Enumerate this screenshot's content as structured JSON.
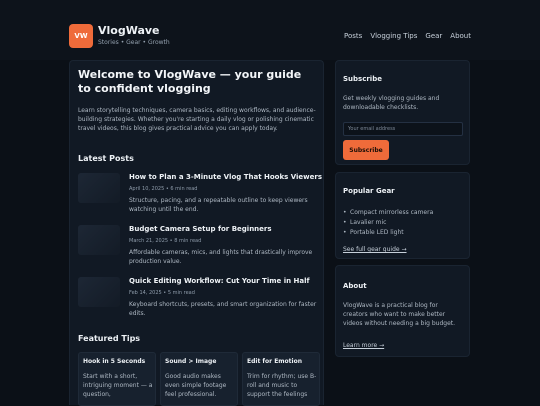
{
  "header": {
    "logo_text": "VW",
    "brand_name": "VlogWave",
    "tagline": "Stories • Gear • Growth",
    "nav": [
      "Posts",
      "Vlogging Tips",
      "Gear",
      "About"
    ]
  },
  "main": {
    "title": "Welcome to VlogWave — your guide to confident vlogging",
    "description": "Learn storytelling techniques, camera basics, editing workflows, and audience-building strategies. Whether you're starting a daily vlog or polishing cinematic travel videos, this blog gives practical advice you can apply today.",
    "latest_heading": "Latest Posts",
    "posts": [
      {
        "title": "How to Plan a 3-Minute Vlog That Hooks Viewers",
        "meta": "April 10, 2025 • 6 min read",
        "excerpt": "Structure, pacing, and a repeatable outline to keep viewers watching until the end."
      },
      {
        "title": "Budget Camera Setup for Beginners",
        "meta": "March 21, 2025 • 8 min read",
        "excerpt": "Affordable cameras, mics, and lights that drastically improve production value."
      },
      {
        "title": "Quick Editing Workflow: Cut Your Time in Half",
        "meta": "Feb 14, 2025 • 5 min read",
        "excerpt": "Keyboard shortcuts, presets, and smart organization for faster edits."
      }
    ],
    "featured_heading": "Featured Tips",
    "tips": [
      {
        "title": "Hook in 5 Seconds",
        "text": "Start with a short, intriguing moment — a question,"
      },
      {
        "title": "Sound > Image",
        "text": "Good audio makes even simple footage feel professional."
      },
      {
        "title": "Edit for Emotion",
        "text": "Trim for rhythm; use B-roll and music to support the feelings"
      }
    ]
  },
  "subscribe": {
    "heading": "Subscribe",
    "text": "Get weekly vlogging guides and downloadable checklists.",
    "placeholder": "Your email address",
    "button": "Subscribe"
  },
  "gear": {
    "heading": "Popular Gear",
    "items": [
      "Compact mirrorless camera",
      "Lavalier mic",
      "Portable LED light"
    ],
    "link": "See full gear guide →"
  },
  "about": {
    "heading": "About",
    "text": "VlogWave is a practical blog for creators who want to make better videos without needing a big budget.",
    "link": "Learn more →"
  }
}
